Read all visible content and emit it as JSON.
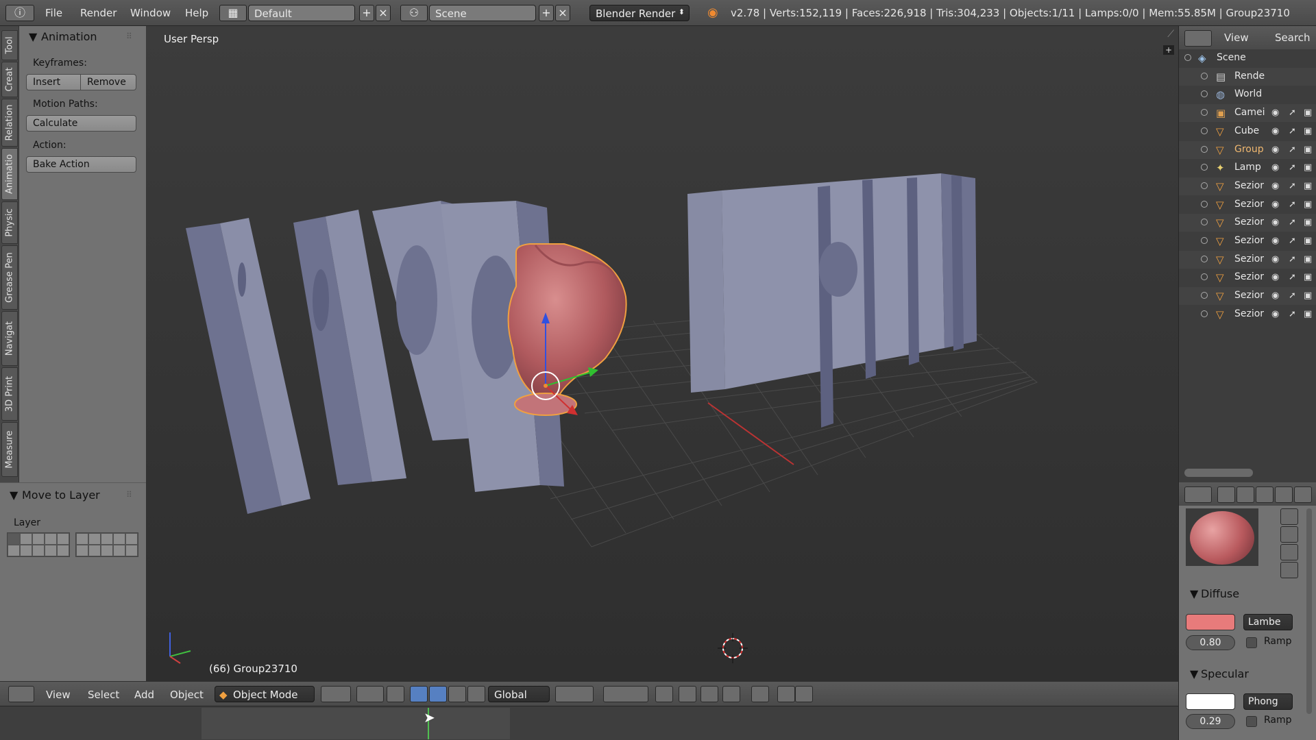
{
  "topbar": {
    "menus": [
      "File",
      "Render",
      "Window",
      "Help"
    ],
    "screen_layout": "Default",
    "scene": "Scene",
    "render_engine": "Blender Render",
    "stats": "v2.78 | Verts:152,119 | Faces:226,918 | Tris:304,233 | Objects:1/11 | Lamps:0/0 | Mem:55.85M | Group23710"
  },
  "tool_tabs": [
    "Tool",
    "Creat",
    "Relation",
    "Animatio",
    "Physic",
    "Grease Pen",
    "Navigat",
    "3D Print",
    "Measure"
  ],
  "animation_panel": {
    "title": "Animation",
    "keyframes_label": "Keyframes:",
    "insert_label": "Insert",
    "remove_label": "Remove",
    "motion_paths_label": "Motion Paths:",
    "calculate_label": "Calculate",
    "action_label": "Action:",
    "bake_action_label": "Bake Action"
  },
  "move_to_layer": {
    "title": "Move to Layer",
    "layer_label": "Layer"
  },
  "viewport": {
    "view_name": "User Persp",
    "active_object": "(66) Group23710"
  },
  "viewport_header": {
    "menus": [
      "View",
      "Select",
      "Add",
      "Object"
    ],
    "mode": "Object Mode",
    "orientation": "Global"
  },
  "outliner": {
    "header_view": "View",
    "header_search": "Search",
    "items": [
      {
        "label": "Scene",
        "icon": "scene-icon",
        "indent": 0
      },
      {
        "label": "Rende",
        "icon": "render-layers-icon",
        "indent": 1
      },
      {
        "label": "World",
        "icon": "world-icon",
        "indent": 1
      },
      {
        "label": "Camei",
        "icon": "camera-icon",
        "indent": 1
      },
      {
        "label": "Cube",
        "icon": "mesh-icon",
        "indent": 1
      },
      {
        "label": "Group",
        "icon": "mesh-icon",
        "indent": 1,
        "selected": true
      },
      {
        "label": "Lamp",
        "icon": "lamp-icon",
        "indent": 1
      },
      {
        "label": "Sezior",
        "icon": "mesh-icon",
        "indent": 1
      },
      {
        "label": "Sezior",
        "icon": "mesh-icon",
        "indent": 1
      },
      {
        "label": "Sezior",
        "icon": "mesh-icon",
        "indent": 1
      },
      {
        "label": "Sezior",
        "icon": "mesh-icon",
        "indent": 1
      },
      {
        "label": "Sezior",
        "icon": "mesh-icon",
        "indent": 1
      },
      {
        "label": "Sezior",
        "icon": "mesh-icon",
        "indent": 1
      },
      {
        "label": "Sezior",
        "icon": "mesh-icon",
        "indent": 1
      },
      {
        "label": "Sezior",
        "icon": "mesh-icon",
        "indent": 1
      }
    ]
  },
  "material": {
    "diffuse_title": "Diffuse",
    "diffuse_color": "#e87b7b",
    "diffuse_shader": "Lambe",
    "diffuse_intensity": "0.80",
    "ramp_label": "Ramp",
    "specular_title": "Specular",
    "specular_color": "#ffffff",
    "specular_shader": "Phong",
    "specular_intensity": "0.29",
    "spec_ramp_label": "Ramp"
  }
}
